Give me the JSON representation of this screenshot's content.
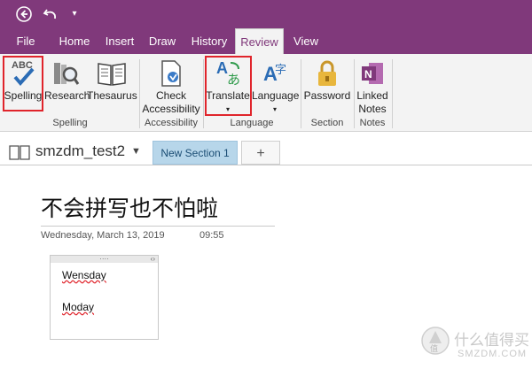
{
  "ribbon_tabs": [
    "File",
    "Home",
    "Insert",
    "Draw",
    "History",
    "Review",
    "View"
  ],
  "ribbon": {
    "spelling": "Spelling",
    "research": "Research",
    "thesaurus": "Thesaurus",
    "check_accessibility_1": "Check",
    "check_accessibility_2": "Accessibility",
    "translate": "Translate",
    "language": "Language",
    "password": "Password",
    "linked_notes_1": "Linked",
    "linked_notes_2": "Notes",
    "groups": {
      "spelling": "Spelling",
      "accessibility": "Accessibility",
      "language": "Language",
      "section": "Section",
      "notes": "Notes"
    },
    "icon_text": {
      "abc": "ABC",
      "translate_glyph": "あ",
      "language_glyph": "字"
    }
  },
  "notebook": {
    "name": "smzdm_test2",
    "section_tab": "New Section 1",
    "add_tab": "+"
  },
  "page": {
    "title": "不会拼写也不怕啦",
    "date": "Wednesday, March 13, 2019",
    "time": "09:55",
    "note_words": [
      "Wensday",
      "Moday"
    ]
  },
  "watermark": {
    "line1": "什么值得买",
    "line2": "SMZDM.COM"
  },
  "colors": {
    "brand": "#80397b",
    "red_highlight": "#e0242b",
    "section_tab": "#b7d6ea"
  }
}
